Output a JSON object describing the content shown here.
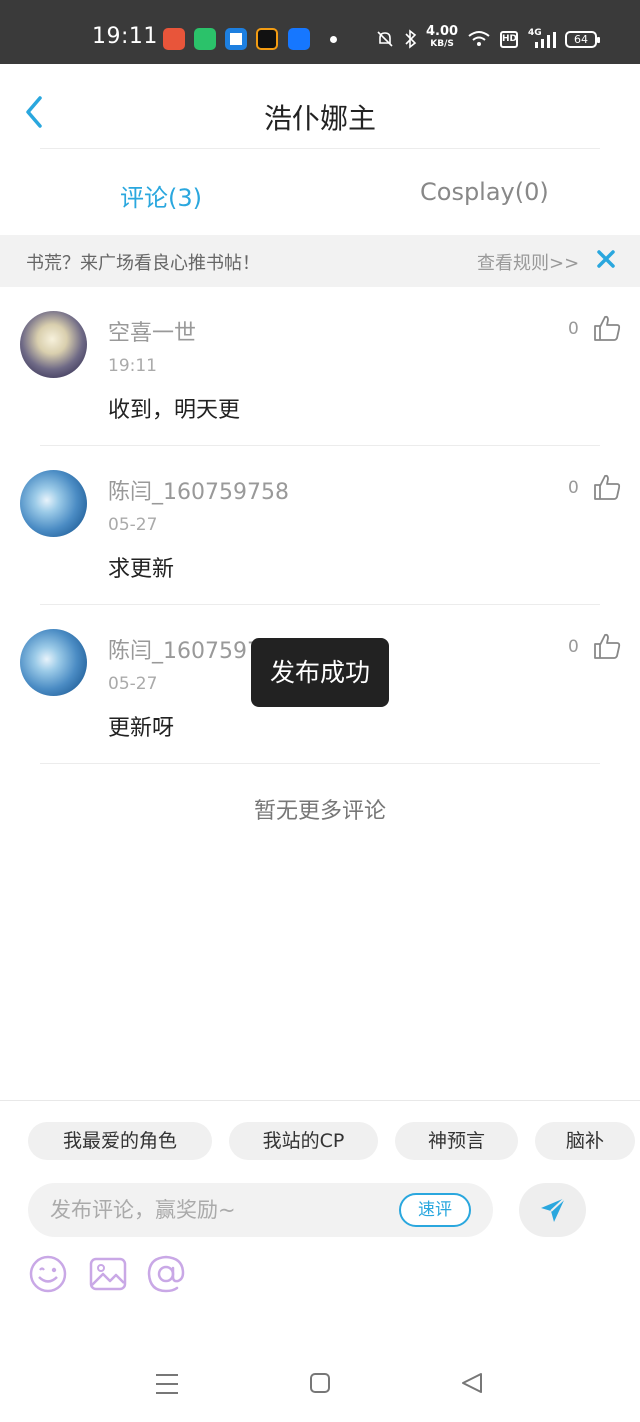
{
  "status_bar": {
    "time": "19:11",
    "speed_value": "4.00",
    "speed_unit": "KB/S",
    "hd_label": "HD",
    "network_label": "4G",
    "battery": "64"
  },
  "header": {
    "title": "浩仆娜主"
  },
  "tabs": [
    {
      "label": "评论(3)",
      "active": true
    },
    {
      "label": "Cosplay(0)",
      "active": false
    }
  ],
  "banner": {
    "text": "书荒？来广场看良心推书帖！",
    "rules_link": "查看规则>>"
  },
  "comments": [
    {
      "username": "空喜一世",
      "time": "19:11",
      "text": "收到，明天更",
      "likes": "0",
      "avatar": "anime-avatar"
    },
    {
      "username": "陈闫_160759758",
      "time": "05-27",
      "text": "求更新",
      "likes": "0",
      "avatar": "sky-avatar"
    },
    {
      "username": "陈闫_160759758",
      "time": "05-27",
      "text": "更新呀",
      "likes": "0",
      "avatar": "sky-avatar"
    }
  ],
  "no_more_text": "暂无更多评论",
  "toast": "发布成功",
  "quick_tags": [
    "我最爱的角色",
    "我站的CP",
    "神预言",
    "脑补"
  ],
  "input": {
    "placeholder": "发布评论，赢奖励~",
    "quick_comment_label": "速评"
  },
  "colors": {
    "accent": "#2aa7de",
    "tool_icon": "#c9a8e6",
    "status_bar_bg": "#3a3a3a"
  }
}
